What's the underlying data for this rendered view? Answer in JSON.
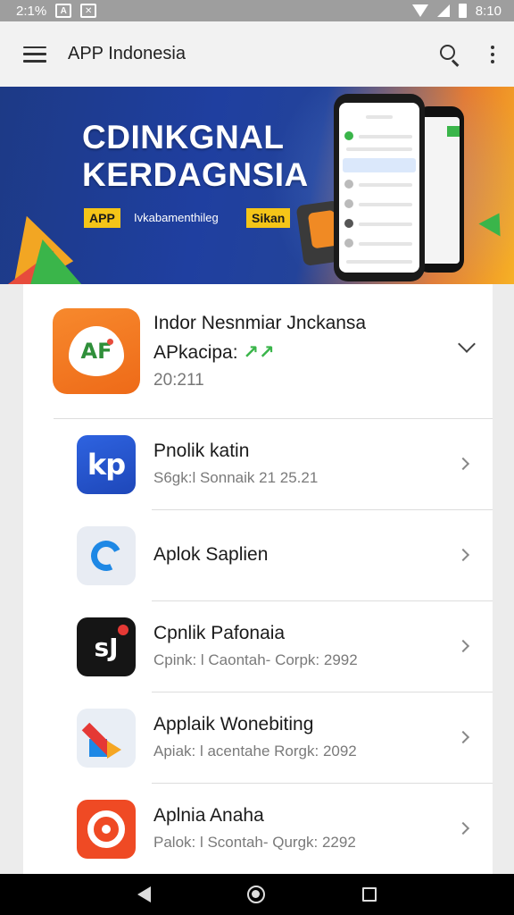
{
  "status_bar": {
    "left_text": "2:1%",
    "time": "8:10"
  },
  "app_bar": {
    "title": "APP Indonesia",
    "icons": [
      "menu-icon",
      "search-icon",
      "more-vert-icon"
    ]
  },
  "banner": {
    "headline_1": "CDINKGNAL",
    "headline_2": "KERDAGNSIA",
    "tag_left": "APP",
    "tag_middle": "Ivkabamenthileg",
    "tag_right": "Sikan",
    "colors": {
      "navy": "#1f3fa0",
      "orange": "#f08a24",
      "yellow": "#f5c518"
    }
  },
  "featured": {
    "title": "Indor Nesnmiar Jnckansa",
    "subtitle": "APkacipa:",
    "subtitle_accent": "↗↗",
    "meta": "20:211",
    "icon_label": "AF"
  },
  "list": [
    {
      "name": "Pnolik katin",
      "meta": "S6gk:l Sonnaik 21 25.21",
      "icon": "kp-app-icon",
      "icon_text": "kp"
    },
    {
      "name": "Aplok Saplien",
      "meta": "",
      "icon": "c-app-icon",
      "icon_text": ""
    },
    {
      "name": "Cpnlik Pafonaia",
      "meta": "Cpink: l Caontah- Corpk: 2992",
      "icon": "sj-app-icon",
      "icon_text": "sJ"
    },
    {
      "name": "Applaik Wonebiting",
      "meta": "Apiak: l acentahe Rorgk: 2092",
      "icon": "pen-app-icon",
      "icon_text": ""
    },
    {
      "name": "Aplnia Anaha",
      "meta": "Palok: l Scontah- Qurgk: 2292",
      "icon": "target-app-icon",
      "icon_text": ""
    }
  ]
}
